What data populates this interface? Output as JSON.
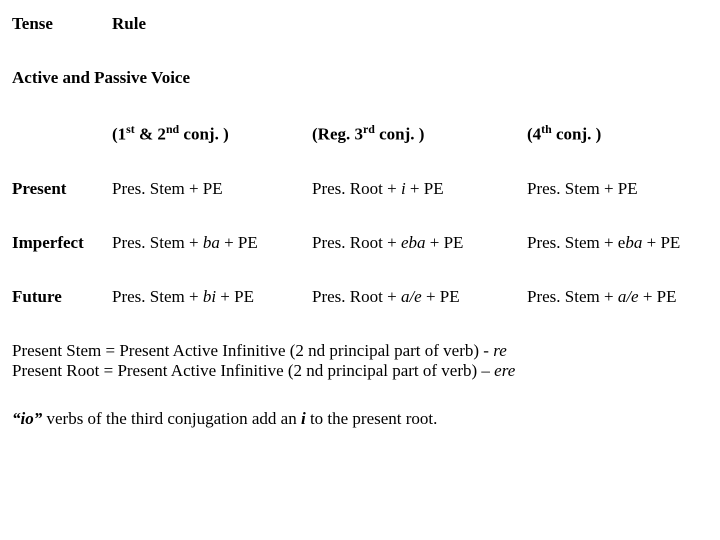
{
  "header": {
    "col_tense": "Tense",
    "col_rule": "Rule"
  },
  "section_title": "Active and Passive Voice",
  "cols": {
    "a_pre": "(1",
    "a_sup1": "st",
    "a_mid": " & 2",
    "a_sup2": "nd",
    "a_post": " conj. )",
    "b_pre": "(Reg. 3",
    "b_sup": "rd",
    "b_post": " conj. )",
    "c_pre": "(4",
    "c_sup": "th",
    "c_post": " conj. )"
  },
  "rows": {
    "present": {
      "label": "Present",
      "a": "Pres. Stem + PE",
      "b_pre": "Pres. Root + ",
      "b_i": "i",
      "b_post": " + PE",
      "c": "Pres. Stem + PE"
    },
    "imperfect": {
      "label": "Imperfect",
      "a_pre": "Pres. Stem + ",
      "a_i": "ba",
      "a_post": " + PE",
      "b_pre": "Pres. Root + ",
      "b_i": "eba",
      "b_post": " + PE",
      "c_pre": "Pres. Stem + e",
      "c_i": "ba",
      "c_post": " + PE"
    },
    "future": {
      "label": "Future",
      "a_pre": "Pres. Stem + ",
      "a_i": "bi",
      "a_post": " + PE",
      "b_pre": "Pres. Root + ",
      "b_i": "a/e",
      "b_post": " + PE",
      "c_pre": "Pres. Stem + ",
      "c_i": "a/e",
      "c_post": " + PE"
    }
  },
  "notes": {
    "stem_pre": "Present Stem = Present Active Infinitive (2 nd principal part of verb) - ",
    "stem_i": "re",
    "root_pre": "Present Root = Present Active Infinitive (2 nd principal part of verb) – ",
    "root_i": "ere",
    "io_pre": "“io” ",
    "io_mid": "verbs of the third conjugation add an ",
    "io_i": "i",
    "io_post": " to the present root."
  }
}
